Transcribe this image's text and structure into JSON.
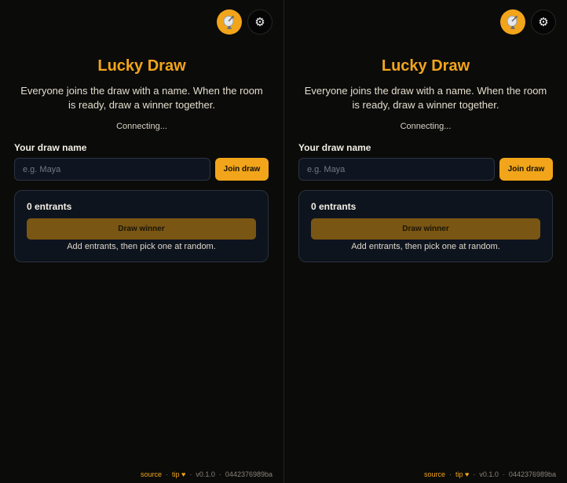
{
  "app": {
    "title": "Lucky Draw",
    "description": "Everyone joins the draw with a name. When the room is ready, draw a winner together.",
    "status": "Connecting..."
  },
  "icons": {
    "antenna": "satellite-antenna-icon",
    "settings": "gear-icon",
    "settings_glyph": "⚙"
  },
  "form": {
    "label": "Your draw name",
    "placeholder": "e.g. Maya",
    "value": "",
    "join_label": "Join draw"
  },
  "draw": {
    "entrants": "0 entrants",
    "draw_label": "Draw winner",
    "hint": "Add entrants, then pick one at random."
  },
  "footer": {
    "source": "source",
    "dot": "·",
    "tip": "tip",
    "heart": "♥",
    "version": "v0.1.0",
    "hash": "0442376989ba"
  },
  "colors": {
    "accent": "#f2a51a",
    "background": "#0b0b0a",
    "card": "#0e141e",
    "draw_button_disabled": "#7a5614"
  }
}
